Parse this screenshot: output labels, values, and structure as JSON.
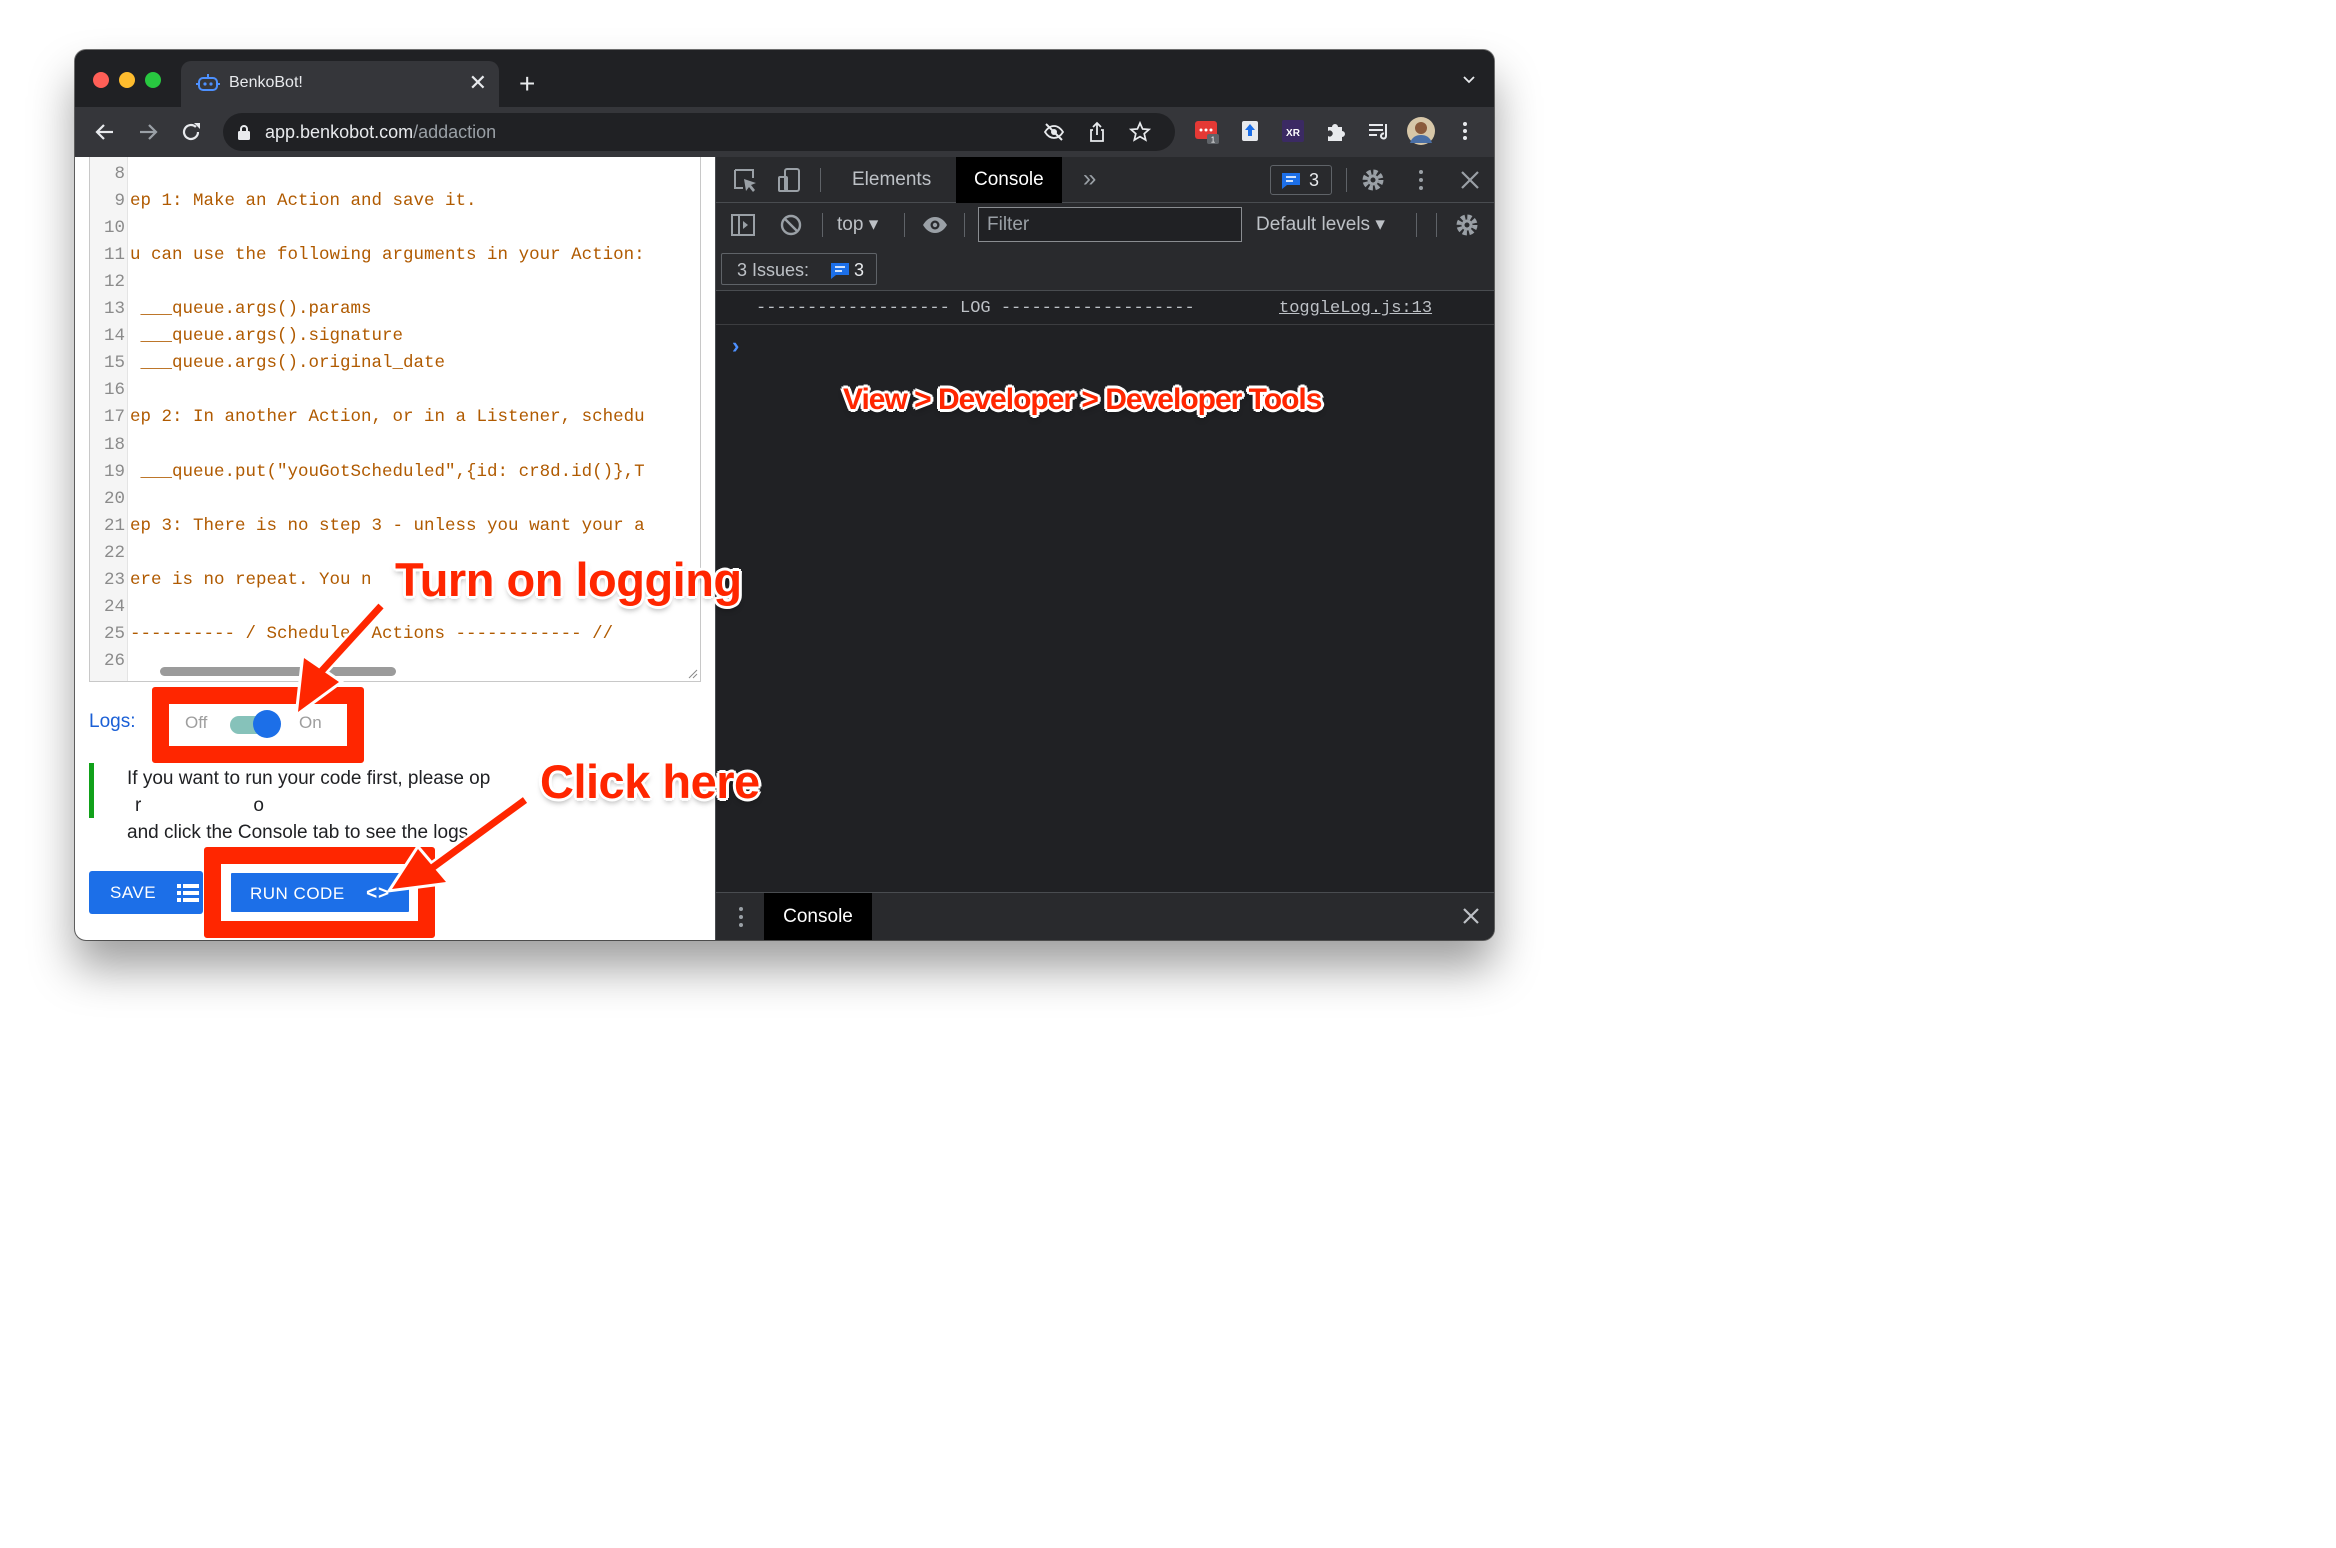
{
  "browser": {
    "tab_title": "BenkoBot!",
    "tab_close": "✕",
    "new_tab": "+",
    "url_host": "app.benkobot.com",
    "url_path": "/addaction",
    "extension_badge": "1"
  },
  "editor": {
    "lines": [
      {
        "num": "8",
        "code": ""
      },
      {
        "num": "9",
        "code": "ep 1: Make an Action and save it."
      },
      {
        "num": "10",
        "code": ""
      },
      {
        "num": "11",
        "code": "u can use the following arguments in your Action:"
      },
      {
        "num": "12",
        "code": ""
      },
      {
        "num": "13",
        "code": " ___queue.args().params"
      },
      {
        "num": "14",
        "code": " ___queue.args().signature"
      },
      {
        "num": "15",
        "code": " ___queue.args().original_date"
      },
      {
        "num": "16",
        "code": ""
      },
      {
        "num": "17",
        "code": "ep 2: In another Action, or in a Listener, schedu"
      },
      {
        "num": "18",
        "code": ""
      },
      {
        "num": "19",
        "code": " ___queue.put(\"youGotScheduled\",{id: cr8d.id()},T"
      },
      {
        "num": "20",
        "code": ""
      },
      {
        "num": "21",
        "code": "ep 3: There is no step 3 - unless you want your a"
      },
      {
        "num": "22",
        "code": ""
      },
      {
        "num": "23",
        "code": "ere is no repeat. You n"
      },
      {
        "num": "24",
        "code": ""
      },
      {
        "num": "25",
        "code": "---------- / Scheduled Actions ------------ //"
      },
      {
        "num": "26",
        "code": ""
      }
    ]
  },
  "logs": {
    "label": "Logs:",
    "off_label": "Off",
    "on_label": "On",
    "enabled": true
  },
  "info": {
    "line1": "If you want to run your code first, please op",
    "line1_tail": "r",
    "line1_end": "o",
    "line2": "and click the Console tab to see the logs."
  },
  "buttons": {
    "save_label": "SAVE",
    "run_label": "RUN CODE",
    "run_icon": "<>"
  },
  "devtools": {
    "tabs": [
      "Elements",
      "Console"
    ],
    "active_tab": "Console",
    "more_tabs": "»",
    "issues_count": "3",
    "context": "top ▾",
    "filter_placeholder": "Filter",
    "levels": "Default levels ▾",
    "issues_label": "3 Issues:",
    "issues_num": "3",
    "log_message": "------------------- LOG -------------------",
    "log_source": "toggleLog.js:13",
    "prompt": "›",
    "drawer_tab": "Console"
  },
  "annotations": {
    "menu_path": "View > Developer > Developer Tools",
    "turn_on": "Turn on logging",
    "click_here": "Click here",
    "color": "#ff2600"
  },
  "colors": {
    "accent": "#1c6fe8",
    "code": "#b05a00",
    "info_bar": "#11a11a"
  }
}
